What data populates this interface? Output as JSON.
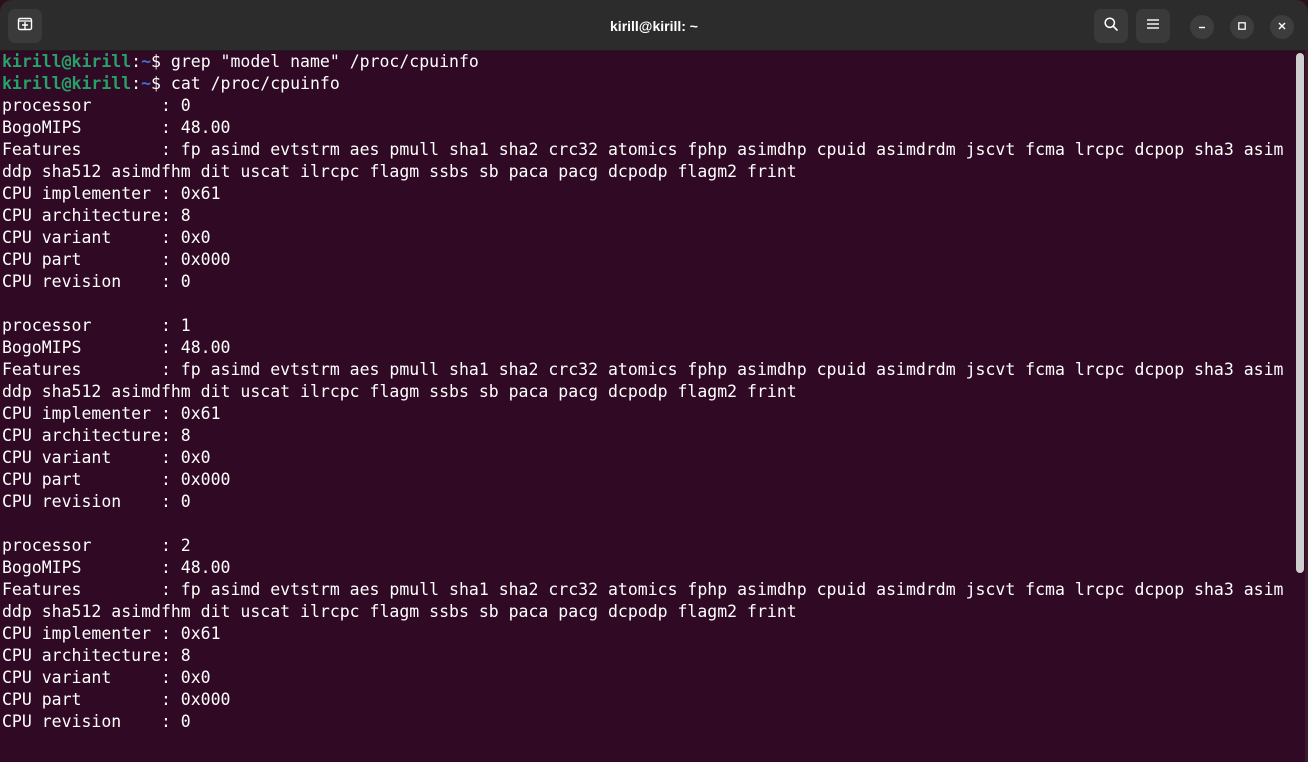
{
  "window": {
    "title": "kirill@kirill: ~"
  },
  "icons": {
    "new_tab": "new-tab-icon",
    "search": "search-icon",
    "menu": "hamburger-menu-icon",
    "minimize": "minimize-icon",
    "maximize": "maximize-icon",
    "close": "close-icon"
  },
  "colors": {
    "terminal_bg": "#300a24",
    "prompt_user": "#26a269",
    "prompt_path": "#3b6fd6",
    "titlebar_bg": "#2c2c2c"
  },
  "terminal": {
    "commands": [
      {
        "user": "kirill@kirill",
        "sep": ":",
        "path": "~",
        "sym": "$ ",
        "cmd": "grep \"model name\" /proc/cpuinfo"
      },
      {
        "user": "kirill@kirill",
        "sep": ":",
        "path": "~",
        "sym": "$ ",
        "cmd": "cat /proc/cpuinfo"
      }
    ],
    "output": [
      "processor       : 0",
      "BogoMIPS        : 48.00",
      "Features        : fp asimd evtstrm aes pmull sha1 sha2 crc32 atomics fphp asimdhp cpuid asimdrdm jscvt fcma lrcpc dcpop sha3 asim",
      "ddp sha512 asimdfhm dit uscat ilrcpc flagm ssbs sb paca pacg dcpodp flagm2 frint",
      "CPU implementer : 0x61",
      "CPU architecture: 8",
      "CPU variant     : 0x0",
      "CPU part        : 0x000",
      "CPU revision    : 0",
      "",
      "processor       : 1",
      "BogoMIPS        : 48.00",
      "Features        : fp asimd evtstrm aes pmull sha1 sha2 crc32 atomics fphp asimdhp cpuid asimdrdm jscvt fcma lrcpc dcpop sha3 asim",
      "ddp sha512 asimdfhm dit uscat ilrcpc flagm ssbs sb paca pacg dcpodp flagm2 frint",
      "CPU implementer : 0x61",
      "CPU architecture: 8",
      "CPU variant     : 0x0",
      "CPU part        : 0x000",
      "CPU revision    : 0",
      "",
      "processor       : 2",
      "BogoMIPS        : 48.00",
      "Features        : fp asimd evtstrm aes pmull sha1 sha2 crc32 atomics fphp asimdhp cpuid asimdrdm jscvt fcma lrcpc dcpop sha3 asim",
      "ddp sha512 asimdfhm dit uscat ilrcpc flagm ssbs sb paca pacg dcpodp flagm2 frint",
      "CPU implementer : 0x61",
      "CPU architecture: 8",
      "CPU variant     : 0x0",
      "CPU part        : 0x000",
      "CPU revision    : 0"
    ]
  }
}
